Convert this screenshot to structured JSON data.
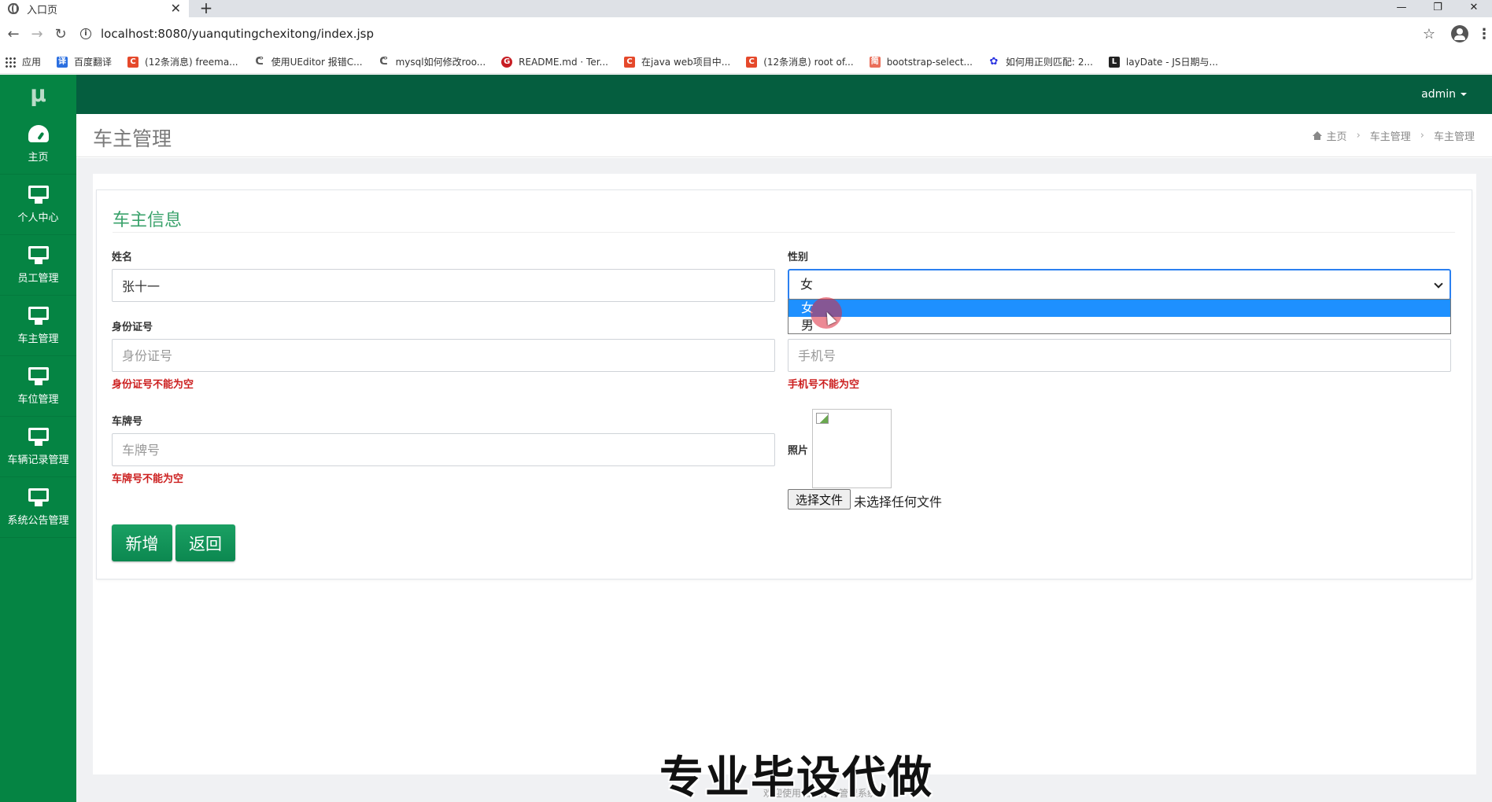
{
  "browser": {
    "tab_title": "入口页",
    "tab_close": "✕",
    "new_tab": "+",
    "url": "localhost:8080/yuanqutingchexitong/index.jsp",
    "window_controls": [
      "—",
      "❐",
      "✕"
    ],
    "bookmarks": [
      {
        "label": "应用",
        "icon": "apps-icon",
        "color": "#444444"
      },
      {
        "label": "百度翻译",
        "icon": "baidu-translate-icon",
        "color": "#2b6fe0"
      },
      {
        "label": "(12条消息) freema...",
        "icon": "csdn-icon",
        "color": "#e5492b"
      },
      {
        "label": "使用UEditor 报错C...",
        "icon": "blog-icon",
        "color": "#555555"
      },
      {
        "label": "mysql如何修改roo...",
        "icon": "blog-icon",
        "color": "#555555"
      },
      {
        "label": "README.md · Ter...",
        "icon": "gitee-icon",
        "color": "#c71d23"
      },
      {
        "label": "在java web项目中...",
        "icon": "csdn-icon",
        "color": "#e5492b"
      },
      {
        "label": "(12条消息) root of...",
        "icon": "csdn-icon",
        "color": "#e5492b"
      },
      {
        "label": "bootstrap-select...",
        "icon": "jianshu-icon",
        "color": "#ea6f5a"
      },
      {
        "label": "如何用正则匹配: 2...",
        "icon": "baidu-icon",
        "color": "#2932e1"
      },
      {
        "label": "layDate - JS日期与...",
        "icon": "layui-icon",
        "color": "#222222"
      }
    ]
  },
  "app": {
    "logo": "μ",
    "user": "admin",
    "sidebar": [
      {
        "label": "主页",
        "icon": "dashboard-icon"
      },
      {
        "label": "个人中心",
        "icon": "monitor-icon"
      },
      {
        "label": "员工管理",
        "icon": "monitor-icon"
      },
      {
        "label": "车主管理",
        "icon": "monitor-icon"
      },
      {
        "label": "车位管理",
        "icon": "monitor-icon"
      },
      {
        "label": "车辆记录管理",
        "icon": "monitor-icon"
      },
      {
        "label": "系统公告管理",
        "icon": "monitor-icon"
      }
    ],
    "page_title": "车主管理",
    "breadcrumb": [
      "主页",
      "车主管理",
      "车主管理"
    ]
  },
  "form": {
    "title": "车主信息",
    "name": {
      "label": "姓名",
      "value": "张十一"
    },
    "gender": {
      "label": "性别",
      "selected": "女",
      "options": [
        "女",
        "男"
      ]
    },
    "id_card": {
      "label": "身份证号",
      "placeholder": "身份证号",
      "error": "身份证号不能为空"
    },
    "phone": {
      "placeholder": "手机号",
      "error": "手机号不能为空"
    },
    "plate": {
      "label": "车牌号",
      "placeholder": "车牌号",
      "error": "车牌号不能为空"
    },
    "photo": {
      "label": "照片",
      "file_button": "选择文件",
      "file_status": "未选择任何文件"
    },
    "submit": "新增",
    "back": "返回"
  },
  "overlay": {
    "watermark": "专业毕设代做",
    "footer": "欢迎使用园区停车管理系统"
  },
  "colors": {
    "sidebar": "#058443",
    "topbar": "#055e3f",
    "accent": "#3aa26b",
    "error": "#cc1f1f",
    "select_highlight": "#1e90ff"
  }
}
